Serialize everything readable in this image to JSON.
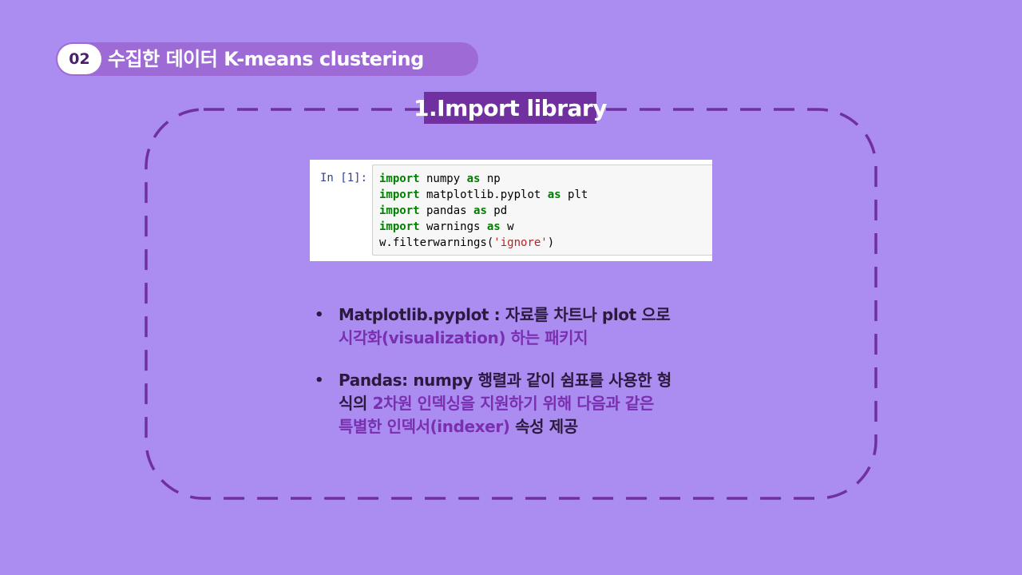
{
  "header": {
    "number": "02",
    "title": "수집한 데이터 K-means clustering"
  },
  "section_label": "1.Import  library",
  "code_cell": {
    "prompt": "In [1]:",
    "lines": [
      {
        "kw1": "import",
        "text1": " numpy ",
        "kw2": "as",
        "text2": " np"
      },
      {
        "kw1": "import",
        "text1": " matplotlib.pyplot ",
        "kw2": "as",
        "text2": " plt"
      },
      {
        "kw1": "import",
        "text1": " pandas ",
        "kw2": "as",
        "text2": " pd"
      },
      {
        "kw1": "import",
        "text1": " warnings ",
        "kw2": "as",
        "text2": " w"
      }
    ],
    "last_line": {
      "prefix": "w.filterwarnings(",
      "string": "'ignore'",
      "suffix": ")"
    }
  },
  "bullets": [
    {
      "dot": "•",
      "line1_dark": "Matplotlib.pyplot : 자료를 차트나 plot 으로",
      "line2_purple": "시각화(visualization) 하는 패키지"
    },
    {
      "dot": "•",
      "line1_dark": "Pandas: numpy 행렬과 같이 쉼표를 사용한 형",
      "line2_dark": "식의 ",
      "line2_purple": "2차원 인덱싱을 지원하기 위해 다음과 같은",
      "line3_purple": "특별한 인덱서(indexer) ",
      "line3_dark": "속성 제공"
    }
  ]
}
